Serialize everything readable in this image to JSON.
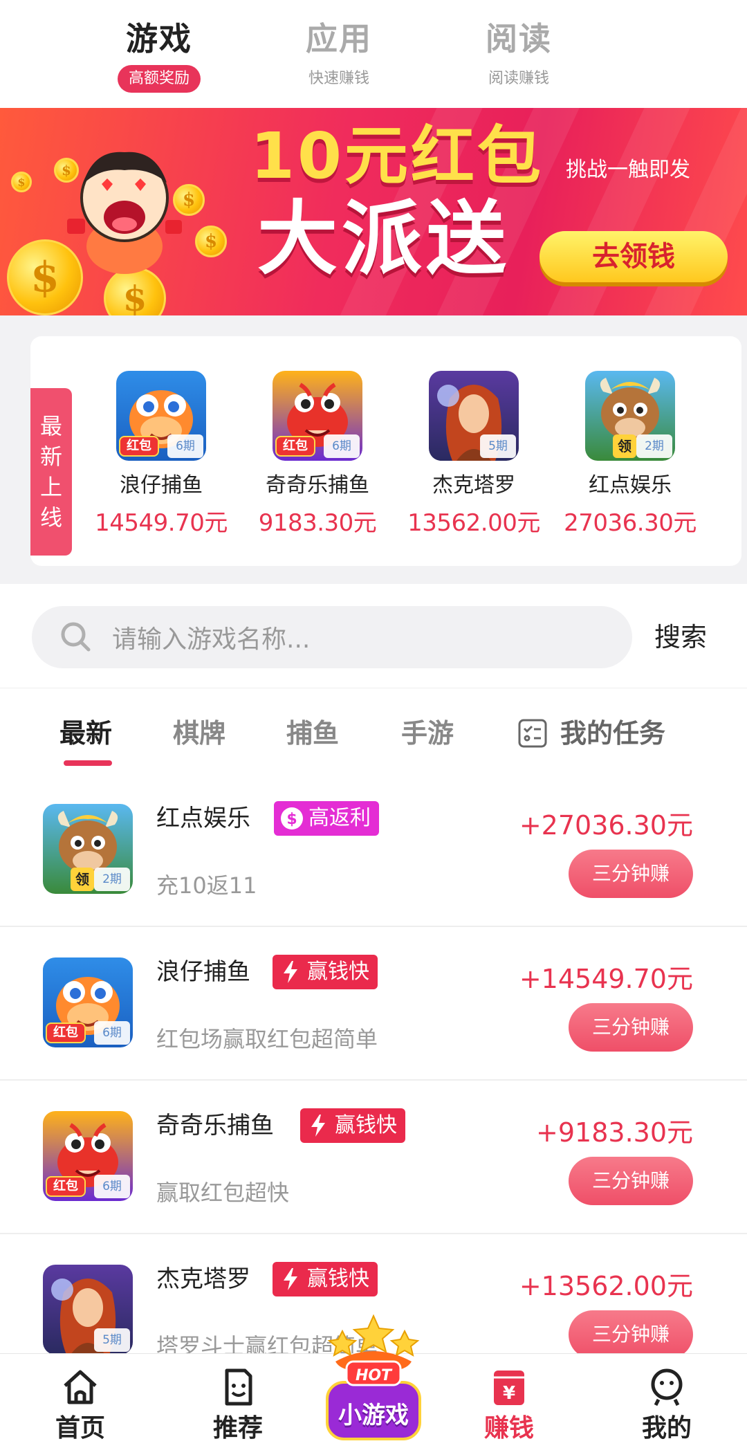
{
  "top_tabs": [
    {
      "title": "游戏",
      "sub": "高额奖励",
      "active": true
    },
    {
      "title": "应用",
      "sub": "快速赚钱",
      "active": false
    },
    {
      "title": "阅读",
      "sub": "阅读赚钱",
      "active": false
    }
  ],
  "banner": {
    "line1": "10元红包",
    "line2": "大派送",
    "challenge": "挑战一触即发",
    "button": "去领钱"
  },
  "new_online": {
    "label": [
      "最",
      "新",
      "上",
      "线"
    ],
    "items": [
      {
        "name": "浪仔捕鱼",
        "amount": "14549.70元",
        "period": "6期",
        "badge": "红包",
        "icon": "fish-mascot-icon"
      },
      {
        "name": "奇奇乐捕鱼",
        "amount": "9183.30元",
        "period": "6期",
        "badge": "红包",
        "icon": "crab-mascot-icon"
      },
      {
        "name": "杰克塔罗",
        "amount": "13562.00元",
        "period": "5期",
        "badge": "",
        "icon": "tarot-girl-icon"
      },
      {
        "name": "红点娱乐",
        "amount": "27036.30元",
        "period": "2期",
        "badge": "领",
        "icon": "bull-mascot-icon"
      }
    ]
  },
  "search": {
    "placeholder": "请输入游戏名称...",
    "button": "搜索"
  },
  "categories": {
    "tabs": [
      "最新",
      "棋牌",
      "捕鱼",
      "手游"
    ],
    "task": "我的任务"
  },
  "games": [
    {
      "name": "红点娱乐",
      "tag": "高返利",
      "tag_style": "purple",
      "desc": "充10返11",
      "amount": "+27036.30元",
      "button": "三分钟赚",
      "period": "2期",
      "badge": "领"
    },
    {
      "name": "浪仔捕鱼",
      "tag": "赢钱快",
      "tag_style": "red",
      "desc": "红包场赢取红包超简单",
      "amount": "+14549.70元",
      "button": "三分钟赚",
      "period": "6期",
      "badge": "红包"
    },
    {
      "name": "奇奇乐捕鱼",
      "tag": "赢钱快",
      "tag_style": "red",
      "desc": "赢取红包超快",
      "amount": "+9183.30元",
      "button": "三分钟赚",
      "period": "6期",
      "badge": "红包"
    },
    {
      "name": "杰克塔罗",
      "tag": "赢钱快",
      "tag_style": "red",
      "desc": "塔罗斗士赢红包超简单",
      "amount": "+13562.00元",
      "button": "三分钟赚",
      "period": "5期",
      "badge": ""
    }
  ],
  "bottom_nav": {
    "items": [
      {
        "label": "首页",
        "icon": "home-icon"
      },
      {
        "label": "推荐",
        "icon": "recommend-icon"
      },
      {
        "label": "赚钱",
        "icon": "yuan-icon",
        "active": true
      },
      {
        "label": "我的",
        "icon": "profile-icon"
      }
    ],
    "hot": {
      "badge": "HOT",
      "label": "小游戏"
    }
  },
  "colors": {
    "accent": "#e8345a",
    "price": "#e8334f",
    "tag_purple": "#e42dd4",
    "tag_red": "#ea2a4c"
  }
}
